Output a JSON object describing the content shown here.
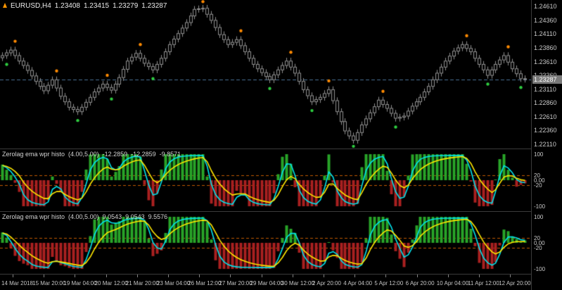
{
  "title": {
    "symbol": "EURUSD,H4",
    "open": "1.23408",
    "high": "1.23415",
    "low": "1.23279",
    "close": "1.23287"
  },
  "price_axis": {
    "labels": [
      "1.24610",
      "1.24360",
      "1.24110",
      "1.23860",
      "1.23610",
      "1.23360",
      "1.23110",
      "1.22860",
      "1.22610",
      "1.22360",
      "1.22110"
    ],
    "current_price": "1.23287"
  },
  "time_axis": {
    "labels": [
      "14 Mar 2018",
      "15 Mar 20:00",
      "19 Mar 04:00",
      "20 Mar 12:00",
      "21 Mar 20:00",
      "23 Mar 04:00",
      "26 Mar 12:00",
      "27 Mar 20:00",
      "29 Mar 04:00",
      "30 Mar 12:00",
      "2 Apr 20:00",
      "4 Apr 04:00",
      "5 Apr 12:00",
      "6 Apr 20:00",
      "10 Apr 04:00",
      "11 Apr 12:00",
      "12 Apr 20:00"
    ]
  },
  "indicators": [
    {
      "name": "Zerolag ema wpr histo",
      "params": "(4.00,5.00)",
      "values": [
        "-12.2859",
        "-12.2859",
        "-9.8571"
      ],
      "axis_labels": [
        "100",
        "20",
        "0.00",
        "-20",
        "-100"
      ]
    },
    {
      "name": "Zerolag ema wpr histo",
      "params": "(4.00,5.00)",
      "values": [
        "9.0543",
        "9.0543",
        "9.5576"
      ],
      "axis_labels": [
        "100",
        "20",
        "0.00",
        "-20",
        "-100"
      ]
    }
  ],
  "colors": {
    "background": "#000000",
    "candle_border": "#8F8F8F",
    "candle_fill": "#050505",
    "price_line": "#4A7296",
    "sell_dot": "#FF8A00",
    "buy_dot": "#2ECC40",
    "hist_up": "#28A428",
    "hist_down": "#AA2020",
    "line_cyan": "#00E5EE",
    "line_yellow": "#FFE800",
    "level_line": "#C25A00",
    "separator": "#3A3A3A",
    "axis_text": "#C8C8C8",
    "badge_bg": "#7A7A7A",
    "badge_text": "#FFFFFF",
    "title_text": "#EBEBEB"
  },
  "chart_data": [
    {
      "type": "candlestick",
      "symbol": "EURUSD",
      "timeframe": "H4",
      "ylim": [
        1.2203,
        1.2473
      ],
      "current_price": 1.23287,
      "candles": [
        [
          1.2368,
          1.2378,
          1.2362,
          1.2372
        ],
        [
          1.2372,
          1.2383,
          1.2366,
          1.2377
        ],
        [
          1.2377,
          1.2388,
          1.2371,
          1.2382
        ],
        [
          1.2382,
          1.2388,
          1.2366,
          1.2372
        ],
        [
          1.2372,
          1.2378,
          1.2356,
          1.2362
        ],
        [
          1.2362,
          1.2368,
          1.2348,
          1.2354
        ],
        [
          1.2354,
          1.236,
          1.2339,
          1.2345
        ],
        [
          1.2345,
          1.2351,
          1.2329,
          1.2335
        ],
        [
          1.2335,
          1.2341,
          1.2319,
          1.2325
        ],
        [
          1.2325,
          1.2331,
          1.231,
          1.2316
        ],
        [
          1.2316,
          1.2322,
          1.2302,
          1.2308
        ],
        [
          1.2308,
          1.2324,
          1.2302,
          1.2318
        ],
        [
          1.2318,
          1.2334,
          1.2312,
          1.2328
        ],
        [
          1.2328,
          1.2334,
          1.2307,
          1.2313
        ],
        [
          1.2313,
          1.2319,
          1.2292,
          1.2298
        ],
        [
          1.2298,
          1.2304,
          1.2282,
          1.2288
        ],
        [
          1.2288,
          1.2294,
          1.2272,
          1.2278
        ],
        [
          1.2278,
          1.2284,
          1.2268,
          1.2274
        ],
        [
          1.2274,
          1.228,
          1.2264,
          1.227
        ],
        [
          1.227,
          1.2284,
          1.2264,
          1.2278
        ],
        [
          1.2278,
          1.2293,
          1.2272,
          1.2287
        ],
        [
          1.2287,
          1.2302,
          1.2281,
          1.2296
        ],
        [
          1.2296,
          1.2312,
          1.229,
          1.2306
        ],
        [
          1.2306,
          1.2319,
          1.23,
          1.2313
        ],
        [
          1.2313,
          1.2326,
          1.2307,
          1.232
        ],
        [
          1.232,
          1.2326,
          1.2308,
          1.2314
        ],
        [
          1.2314,
          1.232,
          1.2303,
          1.2309
        ],
        [
          1.2309,
          1.2326,
          1.2303,
          1.232
        ],
        [
          1.232,
          1.2338,
          1.2314,
          1.2332
        ],
        [
          1.2332,
          1.2353,
          1.2326,
          1.2347
        ],
        [
          1.2347,
          1.2368,
          1.2341,
          1.2362
        ],
        [
          1.2362,
          1.2375,
          1.2356,
          1.2369
        ],
        [
          1.2369,
          1.2382,
          1.2363,
          1.2376
        ],
        [
          1.2376,
          1.2382,
          1.2361,
          1.2367
        ],
        [
          1.2367,
          1.2373,
          1.2352,
          1.2358
        ],
        [
          1.2358,
          1.2364,
          1.2346,
          1.2352
        ],
        [
          1.2352,
          1.2358,
          1.234,
          1.2346
        ],
        [
          1.2346,
          1.2362,
          1.234,
          1.2356
        ],
        [
          1.2356,
          1.2373,
          1.235,
          1.2367
        ],
        [
          1.2367,
          1.2385,
          1.2361,
          1.2379
        ],
        [
          1.2379,
          1.2398,
          1.2373,
          1.2392
        ],
        [
          1.2392,
          1.2408,
          1.2386,
          1.2402
        ],
        [
          1.2402,
          1.2418,
          1.2396,
          1.2412
        ],
        [
          1.2412,
          1.2428,
          1.2406,
          1.2422
        ],
        [
          1.2422,
          1.2438,
          1.2416,
          1.2432
        ],
        [
          1.2432,
          1.245,
          1.2426,
          1.2444
        ],
        [
          1.2444,
          1.2462,
          1.2438,
          1.2456
        ],
        [
          1.2456,
          1.2463,
          1.245,
          1.2457
        ],
        [
          1.2457,
          1.2464,
          1.2451,
          1.2458
        ],
        [
          1.2458,
          1.2464,
          1.2441,
          1.2447
        ],
        [
          1.2447,
          1.2453,
          1.243,
          1.2436
        ],
        [
          1.2436,
          1.2442,
          1.2417,
          1.2423
        ],
        [
          1.2423,
          1.2429,
          1.2404,
          1.241
        ],
        [
          1.241,
          1.2416,
          1.2395,
          1.2401
        ],
        [
          1.2401,
          1.2407,
          1.2386,
          1.2392
        ],
        [
          1.2392,
          1.2402,
          1.2386,
          1.2396
        ],
        [
          1.2396,
          1.2407,
          1.239,
          1.2401
        ],
        [
          1.2401,
          1.2407,
          1.2384,
          1.239
        ],
        [
          1.239,
          1.2396,
          1.2373,
          1.2379
        ],
        [
          1.2379,
          1.2385,
          1.2361,
          1.2367
        ],
        [
          1.2367,
          1.2373,
          1.235,
          1.2356
        ],
        [
          1.2356,
          1.2362,
          1.2342,
          1.2348
        ],
        [
          1.2348,
          1.2354,
          1.2335,
          1.2341
        ],
        [
          1.2341,
          1.2347,
          1.2328,
          1.2334
        ],
        [
          1.2334,
          1.234,
          1.2322,
          1.2328
        ],
        [
          1.2328,
          1.2343,
          1.2322,
          1.2337
        ],
        [
          1.2337,
          1.2352,
          1.2331,
          1.2346
        ],
        [
          1.2346,
          1.236,
          1.234,
          1.2354
        ],
        [
          1.2354,
          1.2368,
          1.2348,
          1.2362
        ],
        [
          1.2362,
          1.2368,
          1.2345,
          1.2351
        ],
        [
          1.2351,
          1.2357,
          1.2334,
          1.234
        ],
        [
          1.234,
          1.2346,
          1.2319,
          1.2325
        ],
        [
          1.2325,
          1.2331,
          1.2304,
          1.231
        ],
        [
          1.231,
          1.2316,
          1.2293,
          1.2299
        ],
        [
          1.2299,
          1.2305,
          1.2282,
          1.2288
        ],
        [
          1.2288,
          1.2298,
          1.2282,
          1.2292
        ],
        [
          1.2292,
          1.2302,
          1.2286,
          1.2296
        ],
        [
          1.2296,
          1.2309,
          1.229,
          1.2303
        ],
        [
          1.2303,
          1.2316,
          1.2297,
          1.231
        ],
        [
          1.231,
          1.2316,
          1.2284,
          1.229
        ],
        [
          1.229,
          1.2296,
          1.2264,
          1.227
        ],
        [
          1.227,
          1.2276,
          1.2246,
          1.2252
        ],
        [
          1.2252,
          1.2258,
          1.2229,
          1.2235
        ],
        [
          1.2235,
          1.2241,
          1.222,
          1.2226
        ],
        [
          1.2226,
          1.2232,
          1.2212,
          1.2218
        ],
        [
          1.2218,
          1.2238,
          1.2212,
          1.2232
        ],
        [
          1.2232,
          1.2252,
          1.2226,
          1.2246
        ],
        [
          1.2246,
          1.2263,
          1.224,
          1.2257
        ],
        [
          1.2257,
          1.2274,
          1.2251,
          1.2268
        ],
        [
          1.2268,
          1.2285,
          1.2262,
          1.2279
        ],
        [
          1.2279,
          1.2297,
          1.2273,
          1.2291
        ],
        [
          1.2291,
          1.2297,
          1.2277,
          1.2283
        ],
        [
          1.2283,
          1.2289,
          1.227,
          1.2276
        ],
        [
          1.2276,
          1.2282,
          1.2261,
          1.2267
        ],
        [
          1.2267,
          1.2273,
          1.2252,
          1.2258
        ],
        [
          1.2258,
          1.2266,
          1.2252,
          1.226
        ],
        [
          1.226,
          1.2268,
          1.2254,
          1.2262
        ],
        [
          1.2262,
          1.2277,
          1.2256,
          1.2271
        ],
        [
          1.2271,
          1.2286,
          1.2265,
          1.228
        ],
        [
          1.228,
          1.2294,
          1.2274,
          1.2288
        ],
        [
          1.2288,
          1.2302,
          1.2282,
          1.2296
        ],
        [
          1.2296,
          1.2312,
          1.229,
          1.2306
        ],
        [
          1.2306,
          1.2322,
          1.23,
          1.2316
        ],
        [
          1.2316,
          1.2334,
          1.231,
          1.2328
        ],
        [
          1.2328,
          1.2346,
          1.2322,
          1.234
        ],
        [
          1.234,
          1.2357,
          1.2334,
          1.2351
        ],
        [
          1.2351,
          1.2368,
          1.2345,
          1.2362
        ],
        [
          1.2362,
          1.2377,
          1.2356,
          1.2371
        ],
        [
          1.2371,
          1.2386,
          1.2365,
          1.238
        ],
        [
          1.238,
          1.2392,
          1.2374,
          1.2386
        ],
        [
          1.2386,
          1.2398,
          1.238,
          1.2392
        ],
        [
          1.2392,
          1.2398,
          1.2379,
          1.2385
        ],
        [
          1.2385,
          1.2391,
          1.2373,
          1.2379
        ],
        [
          1.2379,
          1.2385,
          1.2361,
          1.2367
        ],
        [
          1.2367,
          1.2373,
          1.235,
          1.2356
        ],
        [
          1.2356,
          1.2362,
          1.234,
          1.2346
        ],
        [
          1.2346,
          1.2352,
          1.233,
          1.2336
        ],
        [
          1.2336,
          1.2352,
          1.233,
          1.2346
        ],
        [
          1.2346,
          1.2362,
          1.234,
          1.2356
        ],
        [
          1.2356,
          1.237,
          1.235,
          1.2364
        ],
        [
          1.2364,
          1.2378,
          1.2358,
          1.2372
        ],
        [
          1.2372,
          1.2378,
          1.2354,
          1.236
        ],
        [
          1.236,
          1.2366,
          1.2342,
          1.2348
        ],
        [
          1.2348,
          1.2354,
          1.2333,
          1.2339
        ],
        [
          1.2339,
          1.2345,
          1.2324,
          1.233
        ],
        [
          1.233,
          1.2336,
          1.2323,
          1.23287
        ]
      ],
      "signals": {
        "sell": [
          {
            "i": 3,
            "p": 1.2398
          },
          {
            "i": 13,
            "p": 1.2344
          },
          {
            "i": 25,
            "p": 1.2336
          },
          {
            "i": 33,
            "p": 1.2392
          },
          {
            "i": 48,
            "p": 1.247
          },
          {
            "i": 57,
            "p": 1.2417
          },
          {
            "i": 69,
            "p": 1.2378
          },
          {
            "i": 78,
            "p": 1.2326
          },
          {
            "i": 91,
            "p": 1.2307
          },
          {
            "i": 111,
            "p": 1.2408
          },
          {
            "i": 121,
            "p": 1.2388
          }
        ],
        "buy": [
          {
            "i": 1,
            "p": 1.2356
          },
          {
            "i": 18,
            "p": 1.2254
          },
          {
            "i": 26,
            "p": 1.2293
          },
          {
            "i": 36,
            "p": 1.233
          },
          {
            "i": 64,
            "p": 1.2312
          },
          {
            "i": 74,
            "p": 1.2272
          },
          {
            "i": 84,
            "p": 1.2207
          },
          {
            "i": 94,
            "p": 1.2242
          },
          {
            "i": 116,
            "p": 1.232
          },
          {
            "i": 124,
            "p": 1.2314
          }
        ]
      }
    },
    {
      "type": "bar",
      "name": "Zerolag ema wpr histo",
      "params": "4.00,5.00",
      "ylim": [
        -100,
        100
      ],
      "levels": [
        20,
        -20
      ],
      "smoothing": {
        "cyan": 0.5,
        "yellow": 0.22
      },
      "values": [
        60,
        40,
        20,
        -10,
        -45,
        -100,
        -100,
        -100,
        -100,
        -100,
        -100,
        -77,
        14,
        -14,
        -45,
        -100,
        -100,
        -100,
        -100,
        -45,
        41,
        99,
        100,
        100,
        100,
        81,
        14,
        32,
        54,
        100,
        100,
        100,
        100,
        90,
        -18,
        -77,
        -100,
        -50,
        41,
        100,
        100,
        100,
        100,
        100,
        100,
        100,
        100,
        100,
        100,
        14,
        -90,
        -100,
        -100,
        -100,
        -100,
        -100,
        -41,
        -50,
        -59,
        -100,
        -100,
        -100,
        -100,
        -100,
        -100,
        -50,
        23,
        90,
        100,
        63,
        -27,
        -100,
        -100,
        -100,
        -100,
        -100,
        -63,
        18,
        99,
        -9,
        -100,
        -100,
        -100,
        -100,
        -100,
        -90,
        50,
        100,
        100,
        100,
        100,
        100,
        36,
        -54,
        -100,
        -100,
        -63,
        18,
        99,
        100,
        100,
        100,
        100,
        100,
        100,
        100,
        100,
        100,
        100,
        100,
        100,
        63,
        -5,
        -86,
        -100,
        -100,
        -100,
        -95,
        0,
        81,
        100,
        40,
        10,
        -25,
        -18,
        -12
      ]
    },
    {
      "type": "bar",
      "name": "Zerolag ema wpr histo",
      "params": "4.00,5.00",
      "ylim": [
        -100,
        100
      ],
      "levels": [
        20,
        -20
      ],
      "smoothing": {
        "cyan": 0.5,
        "yellow": 0.22
      },
      "values": [
        40,
        20,
        -20,
        -50,
        -70,
        -80,
        -86,
        -100,
        -100,
        -100,
        -100,
        -100,
        -54,
        -70,
        -86,
        -90,
        -96,
        -100,
        -100,
        -100,
        -35,
        26,
        90,
        100,
        100,
        100,
        70,
        77,
        83,
        100,
        100,
        100,
        100,
        100,
        83,
        16,
        -51,
        -42,
        -29,
        38,
        100,
        100,
        100,
        100,
        100,
        100,
        100,
        100,
        100,
        80,
        13,
        -67,
        -100,
        -100,
        -100,
        -100,
        -100,
        -100,
        -99,
        -100,
        -100,
        -100,
        -100,
        -100,
        -100,
        -96,
        -32,
        19,
        67,
        54,
        38,
        -38,
        -100,
        -100,
        -100,
        -100,
        -100,
        -70,
        0,
        -29,
        -58,
        -100,
        -100,
        -100,
        -100,
        -100,
        -77,
        16,
        100,
        100,
        100,
        100,
        96,
        32,
        -32,
        -61,
        -93,
        -38,
        13,
        67,
        100,
        100,
        100,
        100,
        100,
        100,
        100,
        100,
        100,
        100,
        100,
        100,
        54,
        -13,
        -77,
        -100,
        -100,
        -100,
        -74,
        -10,
        51,
        45,
        25,
        15,
        5,
        9
      ]
    }
  ]
}
